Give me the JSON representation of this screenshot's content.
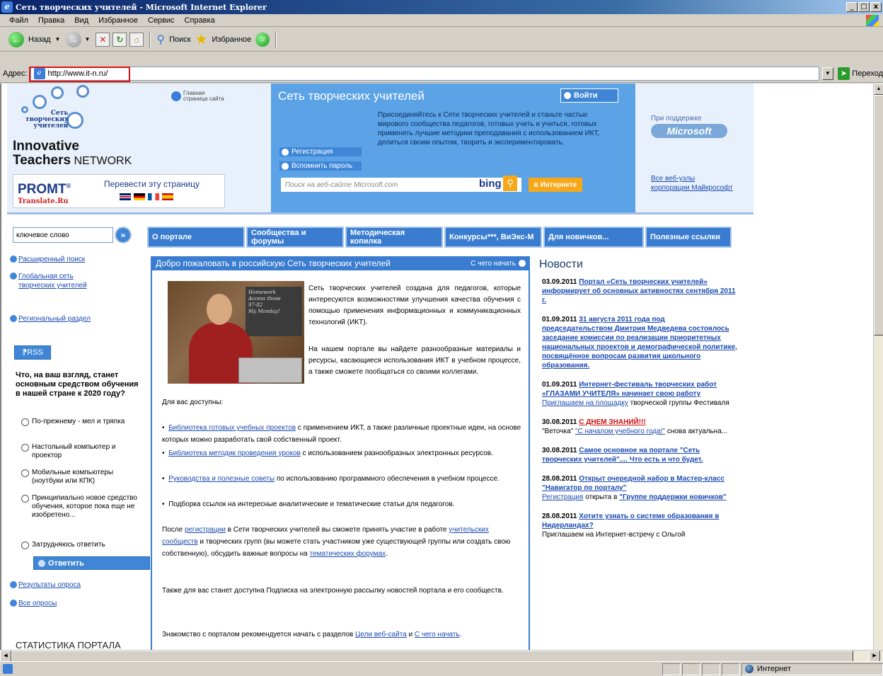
{
  "window": {
    "title": "Сеть творческих учителей - Microsoft Internet Explorer",
    "minimize": "_",
    "maximize": "□",
    "close": "x"
  },
  "menu": [
    "Файл",
    "Правка",
    "Вид",
    "Избранное",
    "Сервис",
    "Справка"
  ],
  "toolbar": {
    "back_label": "Назад",
    "search_label": "Поиск",
    "favorites_label": "Избранное"
  },
  "address": {
    "label": "Адрес:",
    "url": "http://www.it-n.ru/",
    "go_label": "Переход"
  },
  "header": {
    "home_link_line1": "Главная",
    "home_link_line2": "страница сайта",
    "logo_small_1": "Сеть",
    "logo_small_2": "творческих",
    "logo_small_3": "учителей",
    "logo_big_1": "Innovative",
    "logo_big_2a": "Teachers",
    "logo_big_2b": " NETWORK",
    "promt_logo": "PROMT",
    "promt_sub": "Translate.Ru",
    "promt_text": "Перевести эту страницу",
    "site_title": "Сеть творческих учителей",
    "login_label": "Войти",
    "description": "Присоединяйтесь к Сети творческих учителей и станьте частью мирового сообщества педагогов, готовых учить и учиться, готовых применять лучшие методики преподавания с использованием ИКТ, делиться своим опытом, творить и экспериментировать.",
    "register_link": "Регистрация",
    "forgot_link": "Вспомнить пароль",
    "search_placeholder": "Поиск на веб-сайте Microsoft.com",
    "bing": "bing",
    "internet_button": "в Интернете",
    "support_text": "При поддержке",
    "microsoft_logo": "Microsoft",
    "all_sites_1": "Все веб-узлы",
    "all_sites_2": "корпорации Майкрософт"
  },
  "left": {
    "keyword_value": "ключевое слово",
    "advanced_search": "Расширенный поиск",
    "global_network_1": "Глобальная сеть",
    "global_network_2": "творческих учителей",
    "regional": "Региональный раздел",
    "rss": "RSS",
    "poll_question": "Что, на ваш взгляд, станет основным средством обучения в нашей стране к 2020 году?",
    "poll_options": [
      "По-прежнему - мел и тряпка",
      "Настольный компьютер и проектор",
      "Мобильные компьютеры (ноутбуки или КПК)",
      "Принципиально новое средство обучения, которое пока еще не изобретено...",
      "Затрудняюсь ответить"
    ],
    "poll_button": "Ответить",
    "poll_results": "Результаты опроса",
    "all_polls": "Все опросы",
    "stats_title": "СТАТИСТИКА ПОРТАЛА"
  },
  "nav": [
    "О портале",
    "Сообщества и форумы",
    "Методическая копилка",
    "Конкурсы***, ВиЭкс-М",
    "Для новичков...",
    "Полезные ссылки"
  ],
  "welcome": {
    "heading": "Добро пожаловать в российскую Сеть творческих учителей",
    "start_link": "С чего начать",
    "board_text": "Homework\nAccess those\n97-82\nMy Monday!",
    "intro_p1": "Сеть творческих учителей создана для педагогов, которые интересуются возможностями улучшения качества обучения с помощью применения информационных и коммуникационных технологий (ИКТ).",
    "intro_p2": "На нашем портале вы найдете разнообразные материалы и ресурсы, касающиеся использования ИКТ в учебном процессе, а также сможете пообщаться со своими коллегами.",
    "available": "Для вас доступны:",
    "bullet1_link": "Библиотека готовых учебных проектов",
    "bullet1_text": " с применением ИКТ, а также различные проектные идеи, на основе которых можно разработать свой собственный проект.",
    "bullet2_link": "Библиотека методик проведения уроков",
    "bullet2_text": " с использованием разнообразных электронных ресурсов.",
    "bullet3_link": "Руководства и полезные советы",
    "bullet3_text": " по использованию программного обеспечения в учебном процессе.",
    "bullet4_text": "Подборка ссылок на интересные аналитические и тематические статьи для педагогов.",
    "after_1": "После ",
    "after_link1": "регистрации",
    "after_2": " в Сети творческих учителей вы сможете принять участие в работе ",
    "after_link2": "учительских сообществ",
    "after_3": " и творческих групп (вы можете стать участником уже существующей группы или создать свою собственную), обсудить важные вопросы на ",
    "after_link3": "тематических форумах",
    "after_4": ".",
    "subscription": "Также для вас станет доступна Подписка на электронную рассылку новостей портала и его сообществ.",
    "recommend_1": "Знакомство с порталом рекомендуется начать с разделов ",
    "recommend_link1": "Цели веб-сайта",
    "recommend_2": " и ",
    "recommend_link2": "С чего начать",
    "recommend_3": "."
  },
  "news": {
    "title": "Новости",
    "items": [
      {
        "date": "03.09.2011",
        "title": "Портал «Сеть творческих учителей» информирует об основных активностях сентября 2011 г."
      },
      {
        "date": "01.09.2011",
        "title": "31 августа 2011 года под председательством Дмитрия Медведева состоялось заседание комиссии по реализации приоритетных национальных проектов и демографической политике, посвящённое вопросам развития школьного образования."
      },
      {
        "date": "01.09.2011",
        "title": "Интернет-фестиваль творческих работ «ГЛАЗАМИ УЧИТЕЛЯ» начинает свою работу",
        "sub_link": "Приглашаем на площадку",
        "sub_text": " творческой группы Фестиваля"
      },
      {
        "date": "30.08.2011",
        "title": "С ДНЕМ ЗНАНИЙ!!!",
        "sub_pre": "\"Веточка\" ",
        "sub_link": "\"С началом учебного года!\"",
        "sub_text": " снова актуальна..."
      },
      {
        "date": "30.08.2011",
        "title": "Самое основное на портале \"Сеть творческих учителей\".... Что есть и что будет."
      },
      {
        "date": "28.08.2011",
        "title": "Открыт очередной набор в Мастер-класс \"Навигатор по порталу\"",
        "sub_link": "Регистрация",
        "sub_text": " открыта в ",
        "sub_link2": "\"Группе поддержки новичков\""
      },
      {
        "date": "28.08.2011",
        "title": "Хотите узнать о системе образования в Нидерландах?",
        "sub_text": "Приглашаем на Интернет-встречу с Ольгой"
      }
    ]
  },
  "status": {
    "zone": "Интернет"
  },
  "colors": {
    "accent": "#3a7dd0",
    "header_blue": "#5ba3e6",
    "link": "#1a4ab0",
    "orange": "#f7a818",
    "highlight_red": "#e01010"
  }
}
